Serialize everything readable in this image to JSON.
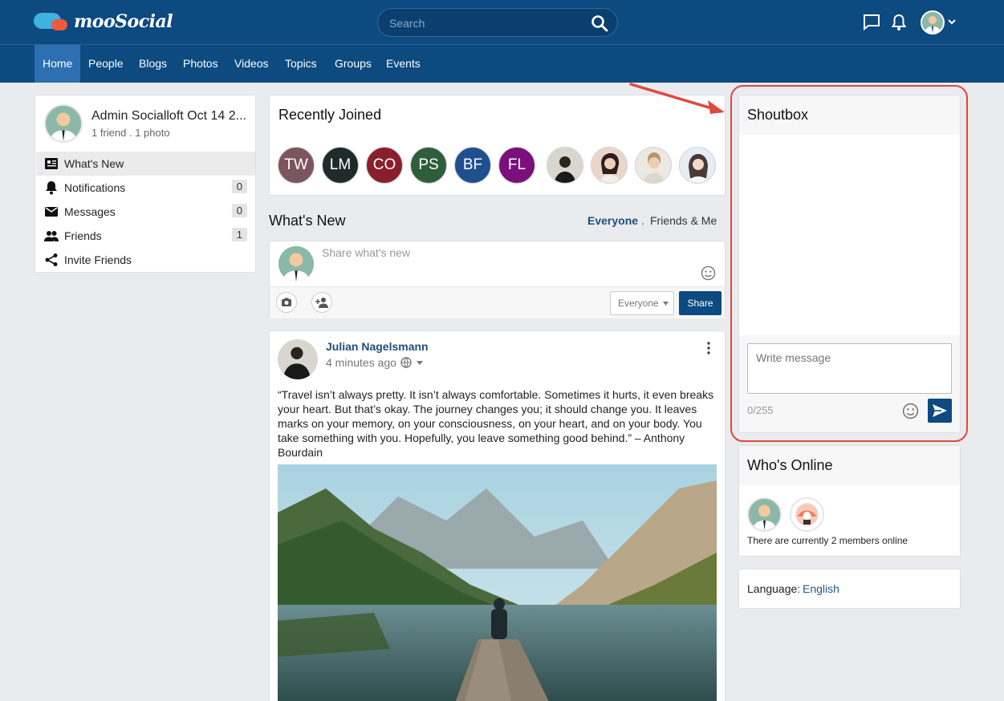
{
  "app": {
    "logo_text": "mooSocial"
  },
  "search": {
    "placeholder": "Search"
  },
  "nav": {
    "items": [
      "Home",
      "People",
      "Blogs",
      "Photos",
      "Videos",
      "Topics",
      "Groups",
      "Events"
    ]
  },
  "profile": {
    "name": "Admin Socialloft Oct 14 2...",
    "stats": "1 friend . 1 photo"
  },
  "sidebar": {
    "items": [
      {
        "label": "What's New",
        "icon": "news-icon"
      },
      {
        "label": "Notifications",
        "icon": "bell-icon",
        "count": "0"
      },
      {
        "label": "Messages",
        "icon": "envelope-icon",
        "count": "0"
      },
      {
        "label": "Friends",
        "icon": "people-icon",
        "count": "1"
      },
      {
        "label": "Invite Friends",
        "icon": "share-icon"
      }
    ]
  },
  "recently_joined": {
    "title": "Recently Joined",
    "members": [
      {
        "initials": "TW",
        "color": "#7b5560"
      },
      {
        "initials": "LM",
        "color": "#1f2b28"
      },
      {
        "initials": "CO",
        "color": "#8a1f2c"
      },
      {
        "initials": "PS",
        "color": "#2e5e3a"
      },
      {
        "initials": "BF",
        "color": "#1f4f8f"
      },
      {
        "initials": "FL",
        "color": "#7b0f7b"
      }
    ]
  },
  "whats_new": {
    "title": "What's New",
    "filter_everyone": "Everyone",
    "filter_sep": ".",
    "filter_friends": "Friends & Me",
    "composer_placeholder": "Share what's new",
    "privacy_value": "Everyone",
    "share_label": "Share"
  },
  "post": {
    "author": "Julian Nagelsmann",
    "time": "4 minutes ago",
    "text": "“Travel isn’t always pretty. It isn’t always comfortable. Sometimes it hurts, it even breaks your heart. But that’s okay. The journey changes you; it should change you. It leaves marks on your memory, on your consciousness, on your heart, and on your body. You take something with you. Hopefully, you leave something good behind.” – Anthony Bourdain"
  },
  "shoutbox": {
    "title": "Shoutbox",
    "placeholder": "Write message",
    "counter": "0/255"
  },
  "whos_online": {
    "title": "Who's Online",
    "text": "There are currently 2 members online"
  },
  "language": {
    "label": "Language:",
    "value": "English"
  },
  "colors": {
    "brand": "#0c4a80",
    "accent": "#2d6fb0",
    "highlight": "#e0483e"
  }
}
